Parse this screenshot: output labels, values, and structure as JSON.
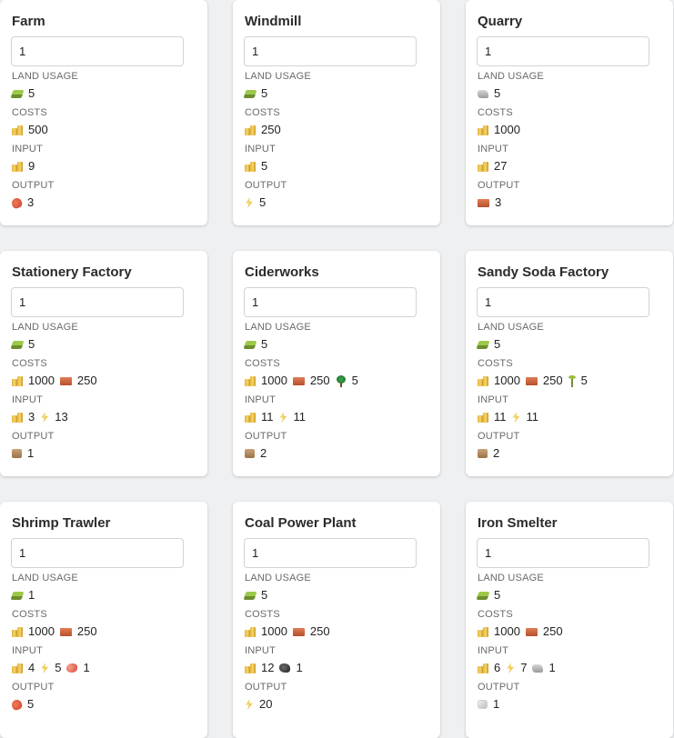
{
  "sections": {
    "land": "LAND USAGE",
    "costs": "COSTS",
    "input": "INPUT",
    "output": "OUTPUT"
  },
  "cards": [
    {
      "title": "Farm",
      "quantity": "1",
      "land": [
        {
          "icon": "land-icon",
          "value": "5"
        }
      ],
      "costs": [
        {
          "icon": "coin-icon",
          "value": "500"
        }
      ],
      "input": [
        {
          "icon": "coin-icon",
          "value": "9"
        }
      ],
      "output": [
        {
          "icon": "food-icon",
          "value": "3"
        }
      ]
    },
    {
      "title": "Windmill",
      "quantity": "1",
      "land": [
        {
          "icon": "land-icon",
          "value": "5"
        }
      ],
      "costs": [
        {
          "icon": "coin-icon",
          "value": "250"
        }
      ],
      "input": [
        {
          "icon": "coin-icon",
          "value": "5"
        }
      ],
      "output": [
        {
          "icon": "power-icon",
          "value": "5"
        }
      ]
    },
    {
      "title": "Quarry",
      "quantity": "1",
      "land": [
        {
          "icon": "stone-icon",
          "value": "5"
        }
      ],
      "costs": [
        {
          "icon": "coin-icon",
          "value": "1000"
        }
      ],
      "input": [
        {
          "icon": "coin-icon",
          "value": "27"
        }
      ],
      "output": [
        {
          "icon": "brick-icon",
          "value": "3"
        }
      ]
    },
    {
      "title": "Stationery Factory",
      "quantity": "1",
      "land": [
        {
          "icon": "land-icon",
          "value": "5"
        }
      ],
      "costs": [
        {
          "icon": "coin-icon",
          "value": "1000"
        },
        {
          "icon": "brick-icon",
          "value": "250"
        }
      ],
      "input": [
        {
          "icon": "coin-icon",
          "value": "3"
        },
        {
          "icon": "power-icon",
          "value": "13"
        }
      ],
      "output": [
        {
          "icon": "box-icon",
          "value": "1"
        }
      ]
    },
    {
      "title": "Ciderworks",
      "quantity": "1",
      "land": [
        {
          "icon": "land-icon",
          "value": "5"
        }
      ],
      "costs": [
        {
          "icon": "coin-icon",
          "value": "1000"
        },
        {
          "icon": "brick-icon",
          "value": "250"
        },
        {
          "icon": "tree-icon",
          "value": "5"
        }
      ],
      "input": [
        {
          "icon": "coin-icon",
          "value": "11"
        },
        {
          "icon": "power-icon",
          "value": "11"
        }
      ],
      "output": [
        {
          "icon": "box-icon",
          "value": "2"
        }
      ]
    },
    {
      "title": "Sandy Soda Factory",
      "quantity": "1",
      "land": [
        {
          "icon": "land-icon",
          "value": "5"
        }
      ],
      "costs": [
        {
          "icon": "coin-icon",
          "value": "1000"
        },
        {
          "icon": "brick-icon",
          "value": "250"
        },
        {
          "icon": "sprout-icon",
          "value": "5"
        }
      ],
      "input": [
        {
          "icon": "coin-icon",
          "value": "11"
        },
        {
          "icon": "power-icon",
          "value": "11"
        }
      ],
      "output": [
        {
          "icon": "box-icon",
          "value": "2"
        }
      ]
    },
    {
      "title": "Shrimp Trawler",
      "quantity": "1",
      "land": [
        {
          "icon": "land-icon",
          "value": "1"
        }
      ],
      "costs": [
        {
          "icon": "coin-icon",
          "value": "1000"
        },
        {
          "icon": "brick-icon",
          "value": "250"
        }
      ],
      "input": [
        {
          "icon": "coin-icon",
          "value": "4"
        },
        {
          "icon": "power-icon",
          "value": "5"
        },
        {
          "icon": "shrimp-icon",
          "value": "1"
        }
      ],
      "output": [
        {
          "icon": "food-icon",
          "value": "5"
        }
      ]
    },
    {
      "title": "Coal Power Plant",
      "quantity": "1",
      "land": [
        {
          "icon": "land-icon",
          "value": "5"
        }
      ],
      "costs": [
        {
          "icon": "coin-icon",
          "value": "1000"
        },
        {
          "icon": "brick-icon",
          "value": "250"
        }
      ],
      "input": [
        {
          "icon": "coin-icon",
          "value": "12"
        },
        {
          "icon": "coal-icon",
          "value": "1"
        }
      ],
      "output": [
        {
          "icon": "power-icon",
          "value": "20"
        }
      ]
    },
    {
      "title": "Iron Smelter",
      "quantity": "1",
      "land": [
        {
          "icon": "land-icon",
          "value": "5"
        }
      ],
      "costs": [
        {
          "icon": "coin-icon",
          "value": "1000"
        },
        {
          "icon": "brick-icon",
          "value": "250"
        }
      ],
      "input": [
        {
          "icon": "coin-icon",
          "value": "6"
        },
        {
          "icon": "power-icon",
          "value": "7"
        },
        {
          "icon": "stone-icon",
          "value": "1"
        }
      ],
      "output": [
        {
          "icon": "metal-icon",
          "value": "1"
        }
      ]
    }
  ]
}
